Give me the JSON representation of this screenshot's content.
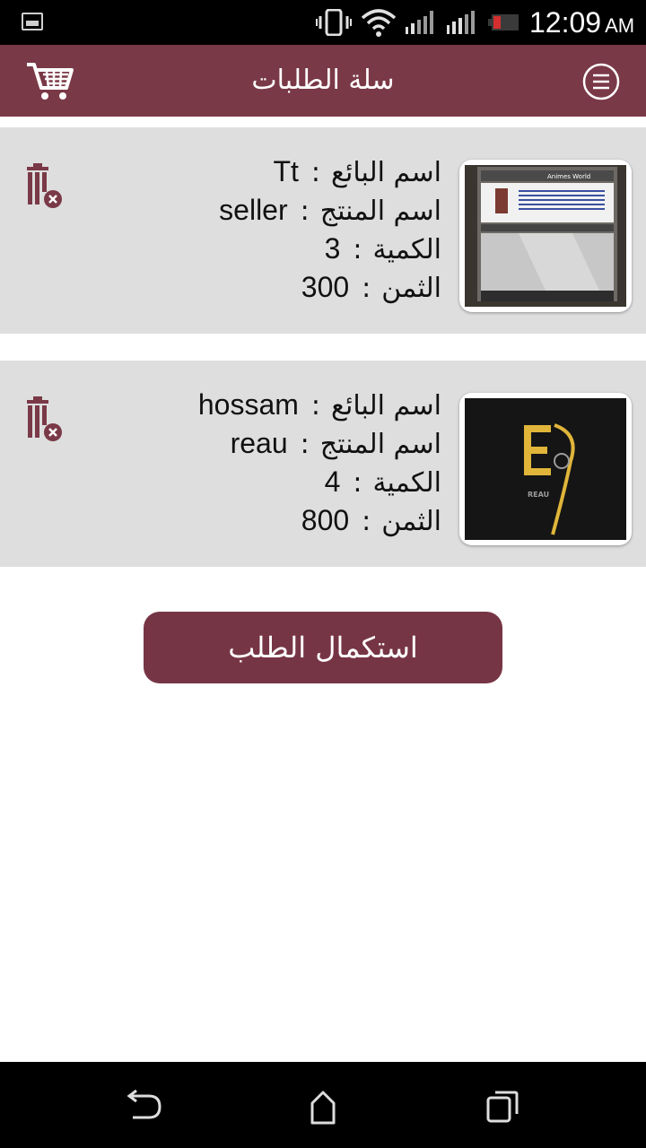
{
  "status_bar": {
    "time": "12:09",
    "ampm": "AM",
    "icons": [
      "gallery-icon",
      "vibrate-icon",
      "wifi-icon",
      "signal-icon",
      "signal-icon",
      "battery-icon"
    ]
  },
  "app_bar": {
    "title": "سلة الطلبات",
    "left_icon": "cart-icon",
    "right_icon": "menu-icon"
  },
  "labels": {
    "seller": "اسم البائع",
    "product": "اسم المنتج",
    "quantity": "الكمية",
    "price": "الثمن",
    "separator": ":"
  },
  "orders": [
    {
      "seller": "Tt",
      "product": "seller",
      "quantity": "3",
      "price": "300",
      "thumb_caption": "Animes World"
    },
    {
      "seller": "hossam",
      "product": "reau",
      "quantity": "4",
      "price": "800",
      "thumb_caption": "REAU"
    }
  ],
  "checkout_button": "استكمال الطلب",
  "colors": {
    "primary": "#7a3947",
    "button": "#763545",
    "card_bg": "#dedede",
    "status_bar": "#000000"
  }
}
